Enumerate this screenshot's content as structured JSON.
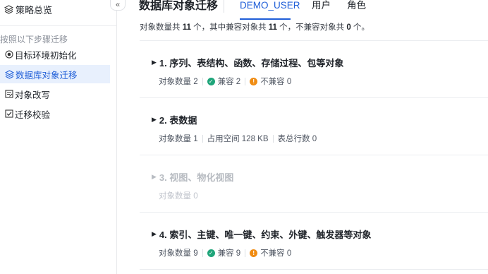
{
  "sidebar": {
    "overview_label": "策略总览",
    "steps_label": "按照以下步骤迁移",
    "items": [
      {
        "label": "目标环境初始化",
        "icon": "target-icon",
        "active": false
      },
      {
        "label": "数据库对象迁移",
        "icon": "layers-icon",
        "active": true
      },
      {
        "label": "对象改写",
        "icon": "edit-doc-icon",
        "active": false
      },
      {
        "label": "迁移校验",
        "icon": "check-square-icon",
        "active": false
      }
    ],
    "collapse_icon": "double-chevron-left-icon"
  },
  "header": {
    "title": "数据库对象迁移",
    "tabs": [
      {
        "label": "DEMO_USER",
        "active": true
      },
      {
        "label": "用户",
        "active": false
      },
      {
        "label": "角色",
        "active": false
      }
    ]
  },
  "summary": {
    "prefix": "对象数量共 ",
    "total": "11",
    "mid1": " 个，其中兼容对象共 ",
    "compatible": "11",
    "mid2": " 个，不兼容对象共 ",
    "incompatible": "0",
    "suffix": " 个。"
  },
  "sections": [
    {
      "title": "1. 序列、表结构、函数、存储过程、包等对象",
      "count_text": "对象数量 2",
      "compatible_text": "兼容 2",
      "incompatible_text": "不兼容 0"
    },
    {
      "title": "2. 表数据",
      "count_text": "对象数量 1",
      "space_text": "占用空间 128 KB",
      "rows_text": "表总行数 0"
    },
    {
      "title": "3. 视图、物化视图",
      "count_text": "对象数量 0",
      "disabled": true
    },
    {
      "title": "4. 索引、主键、唯一键、约束、外键、触发器等对象",
      "count_text": "对象数量 9",
      "compatible_text": "兼容 9",
      "incompatible_text": "不兼容 0"
    }
  ],
  "colors": {
    "accent": "#1f5ed8",
    "active_bg": "#e8f0fd",
    "compatible": "#1fa57a",
    "incompatible": "#f08c13"
  }
}
